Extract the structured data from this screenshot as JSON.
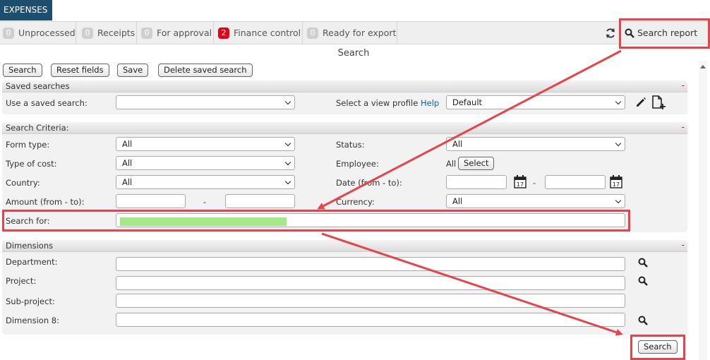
{
  "app": {
    "title": "EXPENSES"
  },
  "tabs": [
    {
      "count": "0",
      "label": "Unprocessed",
      "alert": false
    },
    {
      "count": "0",
      "label": "Receipts",
      "alert": false
    },
    {
      "count": "0",
      "label": "For approval",
      "alert": false
    },
    {
      "count": "2",
      "label": "Finance control",
      "alert": true
    },
    {
      "count": "0",
      "label": "Ready for export",
      "alert": false
    }
  ],
  "toolbar": {
    "search_report_label": "Search report"
  },
  "page": {
    "title": "Search"
  },
  "actions": {
    "search_label": "Search",
    "reset_label": "Reset fields",
    "save_label": "Save",
    "delete_label": "Delete saved search",
    "bottom_search_label": "Search"
  },
  "saved_searches": {
    "header": "Saved searches",
    "collapse": "-",
    "use_saved_label": "Use a saved search:",
    "use_saved_value": "",
    "view_profile_label": "Select a view profile",
    "help_label": "Help",
    "view_profile_value": "Default"
  },
  "criteria": {
    "header": "Search Criteria:",
    "collapse": "-",
    "form_type_label": "Form type:",
    "form_type_value": "All",
    "type_of_cost_label": "Type of cost:",
    "type_of_cost_value": "All",
    "country_label": "Country:",
    "country_value": "All",
    "amount_label": "Amount (from - to):",
    "amount_sep": "-",
    "status_label": "Status:",
    "status_value": "All",
    "employee_label": "Employee:",
    "employee_value": "All",
    "employee_select_label": "Select",
    "date_label": "Date (from - to):",
    "date_sep": "-",
    "calendar_day": "17",
    "currency_label": "Currency:",
    "currency_value": "All",
    "search_for_label": "Search for:"
  },
  "dimensions": {
    "header": "Dimensions",
    "collapse": "-",
    "department_label": "Department:",
    "project_label": "Project:",
    "subproject_label": "Sub-project:",
    "dimension8_label": "Dimension 8:"
  },
  "colors": {
    "header_bg": "#1e4e6e",
    "alert_badge": "#e3001b",
    "annotation": "#e8434b",
    "highlight_fill": "#a5e887",
    "link": "#0a66b0"
  }
}
